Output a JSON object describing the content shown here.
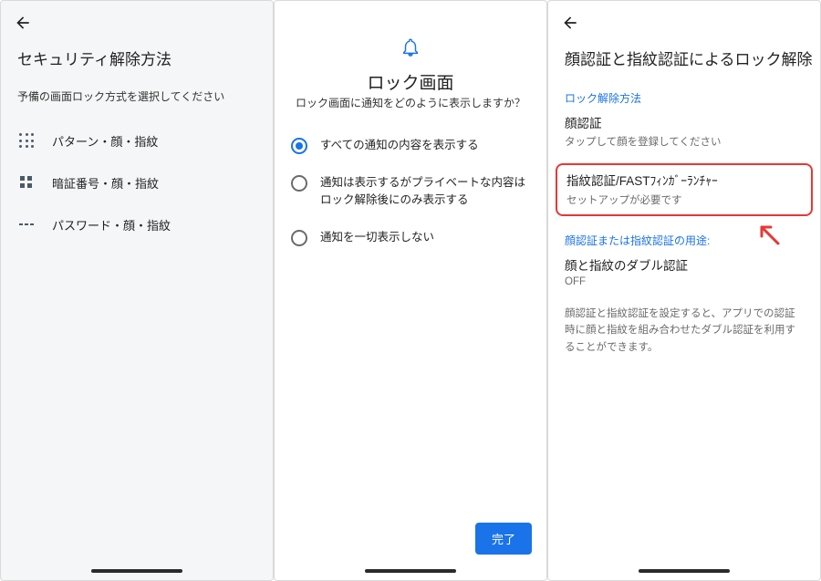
{
  "screenA": {
    "title": "セキュリティ解除方法",
    "subtitle": "予備の画面ロック方式を選択してください",
    "items": [
      {
        "label": "パターン・顔・指紋"
      },
      {
        "label": "暗証番号・顔・指紋"
      },
      {
        "label": "パスワード・顔・指紋"
      }
    ]
  },
  "screenB": {
    "title": "ロック画面",
    "subtitle": "ロック画面に通知をどのように表示しますか？",
    "options": [
      {
        "label": "すべての通知の内容を表示する",
        "selected": true
      },
      {
        "label": "通知は表示するがプライベートな内容はロック解除後にのみ表示する",
        "selected": false
      },
      {
        "label": "通知を一切表示しない",
        "selected": false
      }
    ],
    "done": "完了"
  },
  "screenC": {
    "title": "顔認証と指紋認証によるロック解除",
    "section1_label": "ロック解除方法",
    "face": {
      "title": "顔認証",
      "sub": "タップして顔を登録してください"
    },
    "fp": {
      "title": "指紋認証/FASTﾌｨﾝｶﾞｰﾗﾝﾁｬｰ",
      "sub": "セットアップが必要です"
    },
    "section2_label": "顔認証または指紋認証の用途:",
    "dual": {
      "title": "顔と指紋のダブル認証",
      "sub": "OFF"
    },
    "note": "顔認証と指紋認証を設定すると、アプリでの認証時に顔と指紋を組み合わせたダブル認証を利用することができます。"
  }
}
